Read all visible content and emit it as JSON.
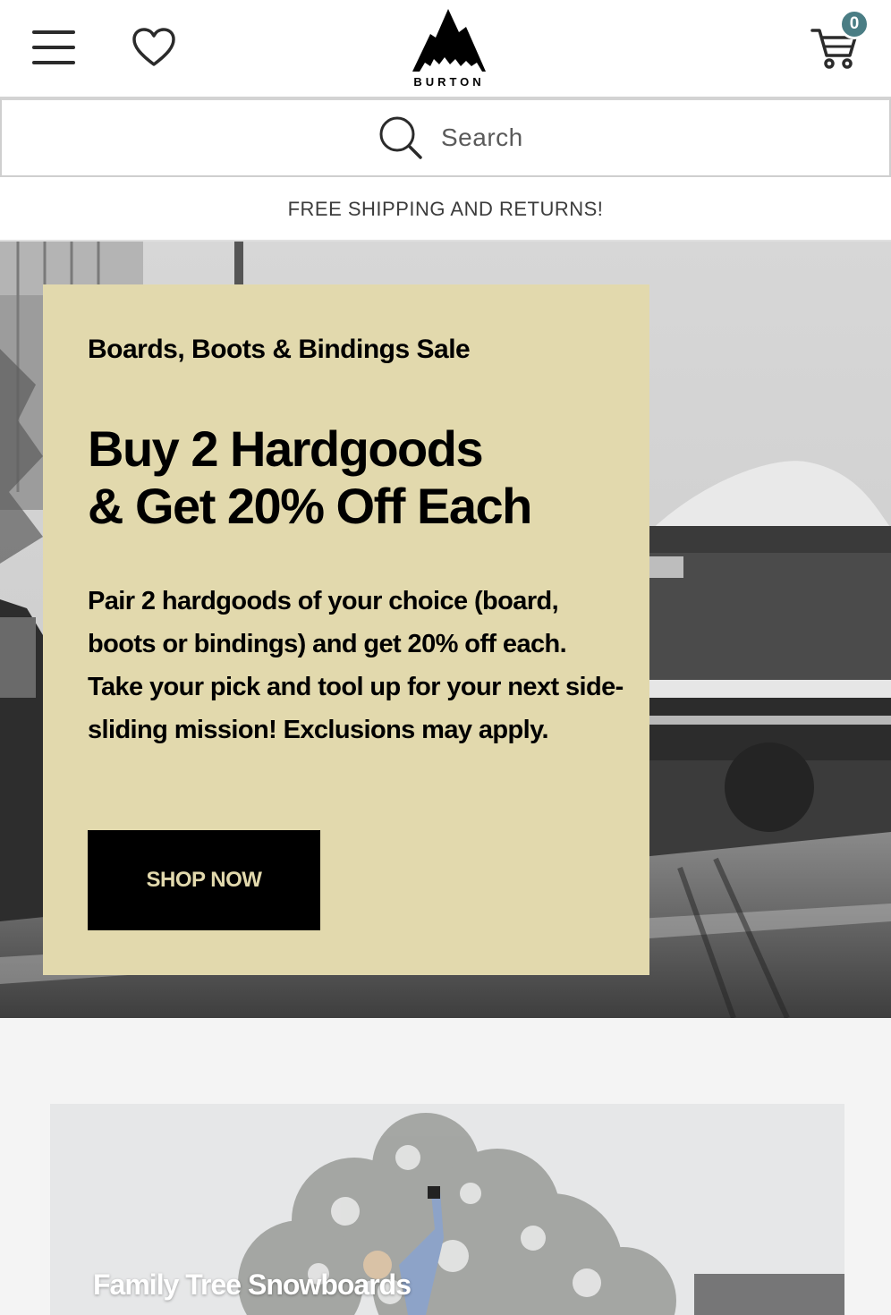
{
  "header": {
    "logo_text": "BURTON",
    "menu_icon": "hamburger-menu-icon",
    "favorites_icon": "heart-icon",
    "cart_icon": "shopping-cart-icon",
    "cart_count": "0",
    "cart_badge_color": "#4a7d84"
  },
  "search": {
    "placeholder": "Search",
    "icon": "search-icon"
  },
  "promo_bar": {
    "text": "FREE SHIPPING AND RETURNS!"
  },
  "hero": {
    "card_color": "#e2d9ad",
    "eyebrow": "Boards, Boots & Bindings Sale",
    "headline_line1": "Buy 2 Hardgoods",
    "headline_line2": "& Get 20% Off Each",
    "body": "Pair 2 hardgoods of your choice (board, boots or bindings) and get 20% off each. Take your pick and tool up for your next side-sliding mission! Exclusions may apply.",
    "cta_label": "SHOP NOW"
  },
  "feature": {
    "title": "Family Tree Snowboards"
  }
}
